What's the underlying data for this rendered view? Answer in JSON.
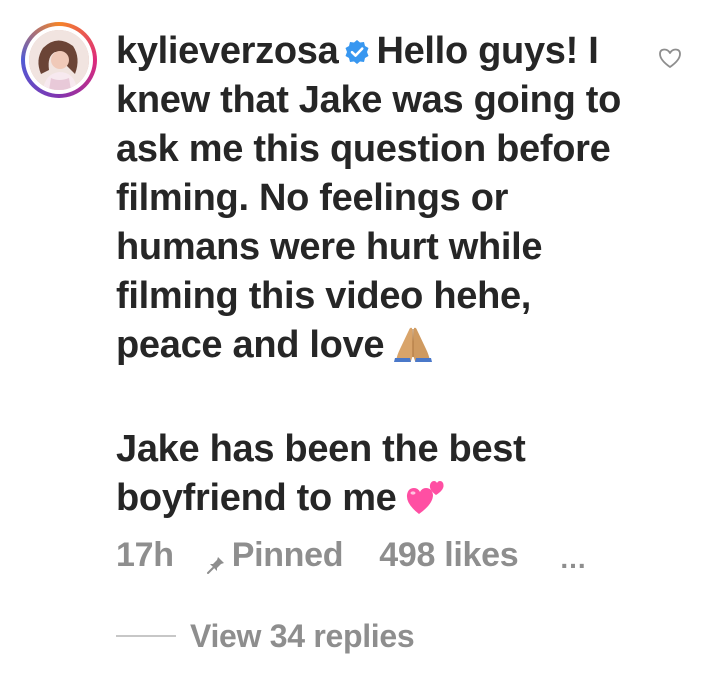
{
  "comment": {
    "username": "kylieverzosa",
    "verified": true,
    "paragraph1": "Hello guys! I knew that Jake was going to ask me this question before filming. No feelings or humans were hurt while filming this video hehe, peace and love",
    "paragraph1_emoji": "folded-hands-emoji",
    "paragraph2": "Jake has been the best boyfriend to me",
    "paragraph2_emoji": "two-hearts-emoji",
    "time": "17h",
    "pinned_label": "Pinned",
    "likes": "498 likes",
    "more": "...",
    "replies_label": "View 34 replies"
  },
  "colors": {
    "text": "#262626",
    "secondary": "#8e8e8e",
    "verified": "#3897f0",
    "heart_emoji": "#ff4fa3"
  },
  "icons": {
    "verified": "verified-badge-icon",
    "like": "heart-outline-icon",
    "pin": "pin-icon"
  }
}
